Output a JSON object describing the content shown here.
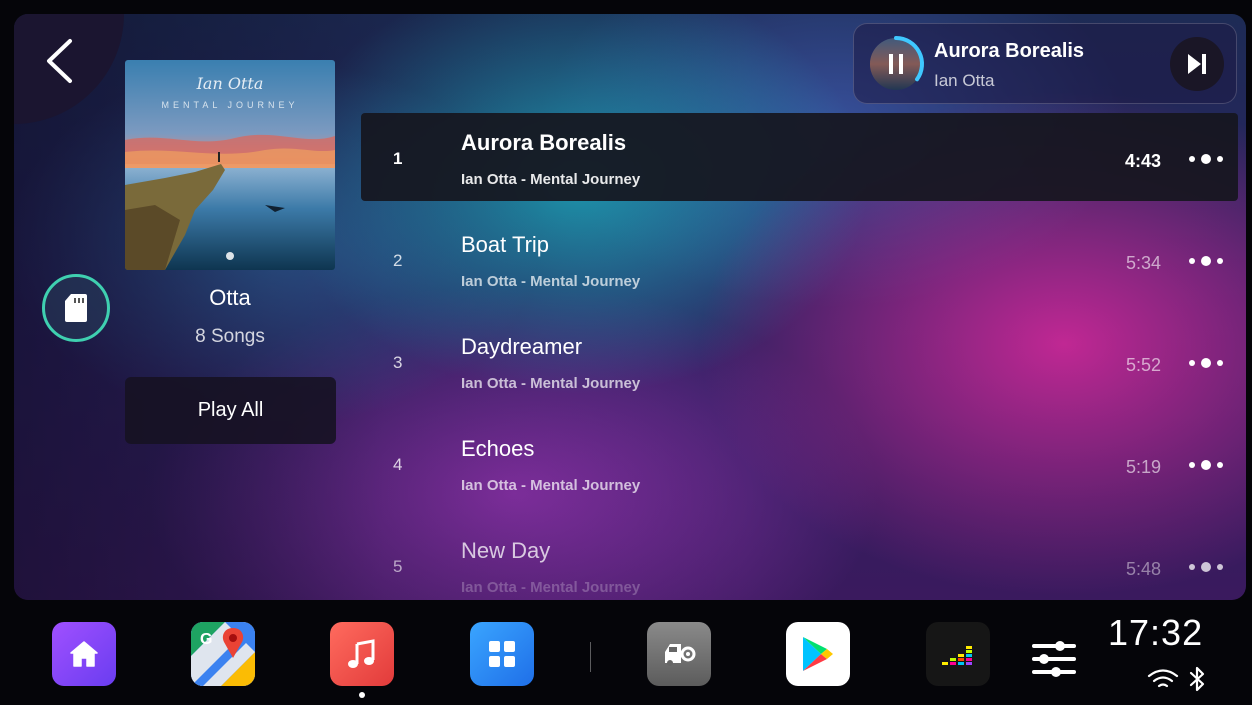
{
  "album": {
    "art_text_script": "Ian Otta",
    "art_text_sub": "MENTAL JOURNEY",
    "artist": "Otta",
    "song_count": "8 Songs",
    "play_all_label": "Play All"
  },
  "now_playing": {
    "title": "Aurora Borealis",
    "artist": "Ian Otta",
    "progress": 0.35
  },
  "tracks": [
    {
      "num": "1",
      "title": "Aurora Borealis",
      "subtitle": "Ian Otta - Mental Journey",
      "duration": "4:43",
      "active": true
    },
    {
      "num": "2",
      "title": "Boat Trip",
      "subtitle": "Ian Otta - Mental Journey",
      "duration": "5:34",
      "active": false
    },
    {
      "num": "3",
      "title": "Daydreamer",
      "subtitle": "Ian Otta - Mental Journey",
      "duration": "5:52",
      "active": false
    },
    {
      "num": "4",
      "title": "Echoes",
      "subtitle": "Ian Otta - Mental Journey",
      "duration": "5:19",
      "active": false
    },
    {
      "num": "5",
      "title": "New Day",
      "subtitle": "Ian Otta - Mental Journey",
      "duration": "5:48",
      "active": false
    }
  ],
  "dock": {
    "apps": [
      "home-icon",
      "maps-icon",
      "music-icon",
      "apps-grid-icon",
      "car-settings-icon",
      "play-store-icon",
      "equalizer-app-icon"
    ],
    "active_app": "music-icon",
    "clock": "17:32"
  },
  "colors": {
    "accent_teal": "#3fd0b0",
    "music_app": "#ef4d4d",
    "home_app": "#8a4dff"
  }
}
